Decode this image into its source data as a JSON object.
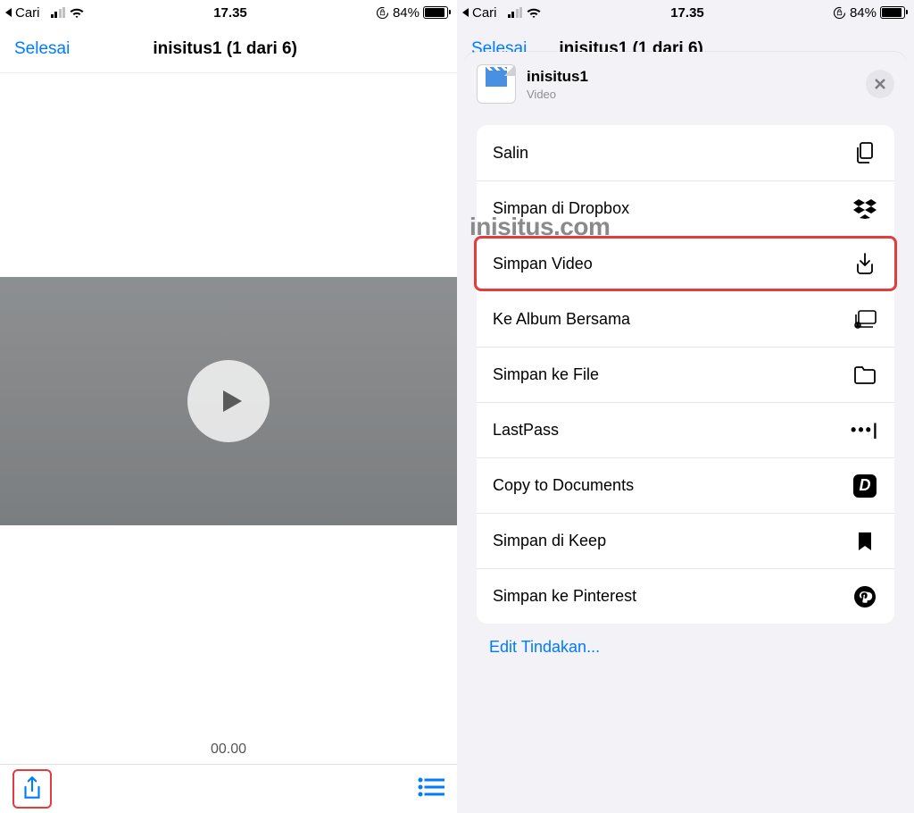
{
  "statusbar": {
    "back_app": "Cari",
    "time": "17.35",
    "battery_pct": "84%"
  },
  "left": {
    "done": "Selesai",
    "title": "inisitus1 (1 dari 6)",
    "timestamp": "00.00"
  },
  "right": {
    "done": "Selesai",
    "bg_title": "inisitus1 (1 dari 6)",
    "sheet": {
      "file_name": "inisitus1",
      "file_type": "Video",
      "actions": {
        "copy": "Salin",
        "dropbox": "Simpan di Dropbox",
        "save_video": "Simpan Video",
        "shared_album": "Ke Album Bersama",
        "save_file": "Simpan ke File",
        "lastpass": "LastPass",
        "documents": "Copy to Documents",
        "keep": "Simpan di Keep",
        "pinterest": "Simpan ke Pinterest"
      },
      "edit_actions": "Edit Tindakan..."
    }
  },
  "watermark": "inisitus.com"
}
